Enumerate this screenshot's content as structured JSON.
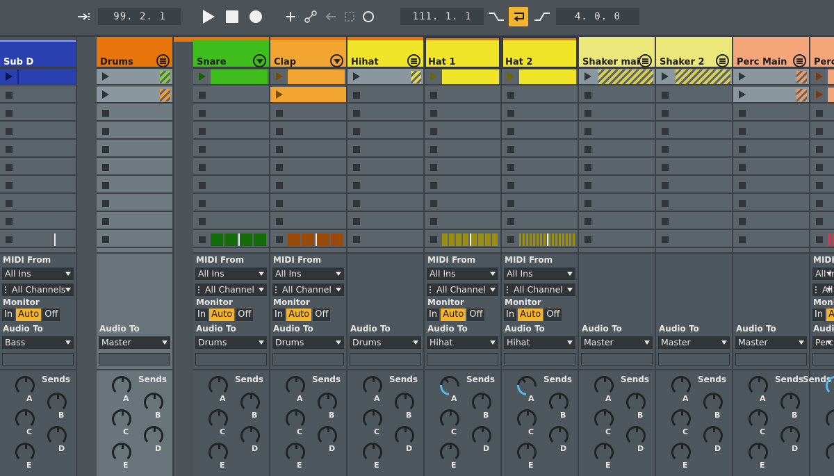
{
  "transport": {
    "arrangement_position": "99. 2. 1",
    "loop_start": "111. 1. 1",
    "loop_length": "4. 0. 0"
  },
  "colors": {
    "background": "#4b5359",
    "slot": "#5b646b",
    "monitor_auto": "#f5b430"
  },
  "labels": {
    "midi_from": "MIDI From",
    "monitor": "Monitor",
    "audio_to": "Audio To",
    "sends": "Sends",
    "mon_in": "In",
    "mon_auto": "Auto",
    "mon_off": "Off",
    "send_a": "A",
    "send_b": "B",
    "send_c": "C",
    "send_d": "D",
    "send_e": "E"
  },
  "tracks": [
    {
      "name": "Sub D",
      "color": "#2a3fb0",
      "text_color": "#ffffff",
      "midi_from": "All Ins",
      "channel": "All Channels",
      "audio_to": "Bass"
    },
    {
      "name": "Drums",
      "color": "#e8740c",
      "text_color": "#1d1d1d",
      "audio_to": "Master"
    },
    {
      "name": "Snare",
      "color": "#3ebd1d",
      "text_color": "#1d1d1d",
      "midi_from": "All Ins",
      "channel": "All Channel",
      "audio_to": "Drums"
    },
    {
      "name": "Clap",
      "color": "#f2a530",
      "text_color": "#1d1d1d",
      "midi_from": "All Ins",
      "channel": "All Channel",
      "audio_to": "Drums"
    },
    {
      "name": "Hihat",
      "color": "#f1e52a",
      "text_color": "#1d1d1d",
      "audio_to": "Drums"
    },
    {
      "name": "Hat 1",
      "color": "#f1e52a",
      "text_color": "#1d1d1d",
      "midi_from": "All Ins",
      "channel": "All Channel",
      "audio_to": "Hihat"
    },
    {
      "name": "Hat 2",
      "color": "#f1e52a",
      "text_color": "#1d1d1d",
      "midi_from": "All Ins",
      "channel": "All Channel",
      "audio_to": "Hihat"
    },
    {
      "name": "Shaker mai",
      "color": "#ece77a",
      "text_color": "#1d1d1d",
      "audio_to": "Master"
    },
    {
      "name": "Shaker 2",
      "color": "#ece77a",
      "text_color": "#1d1d1d",
      "audio_to": "Master"
    },
    {
      "name": "Perc Main",
      "color": "#f4a57a",
      "text_color": "#1d1d1d",
      "audio_to": "Master"
    },
    {
      "name": "Perc",
      "color": "#f4a57a",
      "text_color": "#1d1d1d",
      "midi_from": "All Ins",
      "channel": "All Channel",
      "audio_to": "Perc"
    }
  ]
}
